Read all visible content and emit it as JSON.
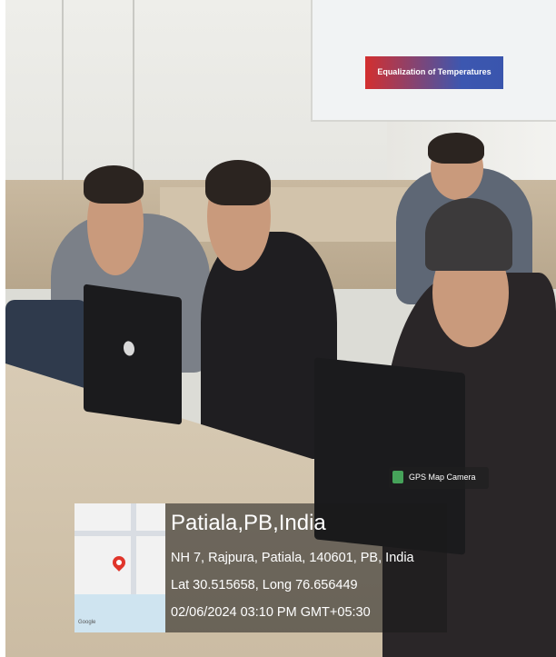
{
  "poster": {
    "banner_text": "Equalization of Temperatures",
    "top_label_left": "",
    "top_label_right": ""
  },
  "gps_overlay": {
    "app_tag": "GPS Map Camera",
    "place_title": "Patiala,PB,India",
    "address": "NH 7, Rajpura, Patiala, 140601, PB, India",
    "coordinates": "Lat 30.515658, Long 76.656449",
    "timestamp": "02/06/2024 03:10 PM GMT+05:30",
    "map_brand": "Google"
  },
  "colors": {
    "banner_red": "#d32f2f",
    "banner_blue": "#3c57b0",
    "pin_red": "#e0352b",
    "tag_green": "#46a35a"
  }
}
